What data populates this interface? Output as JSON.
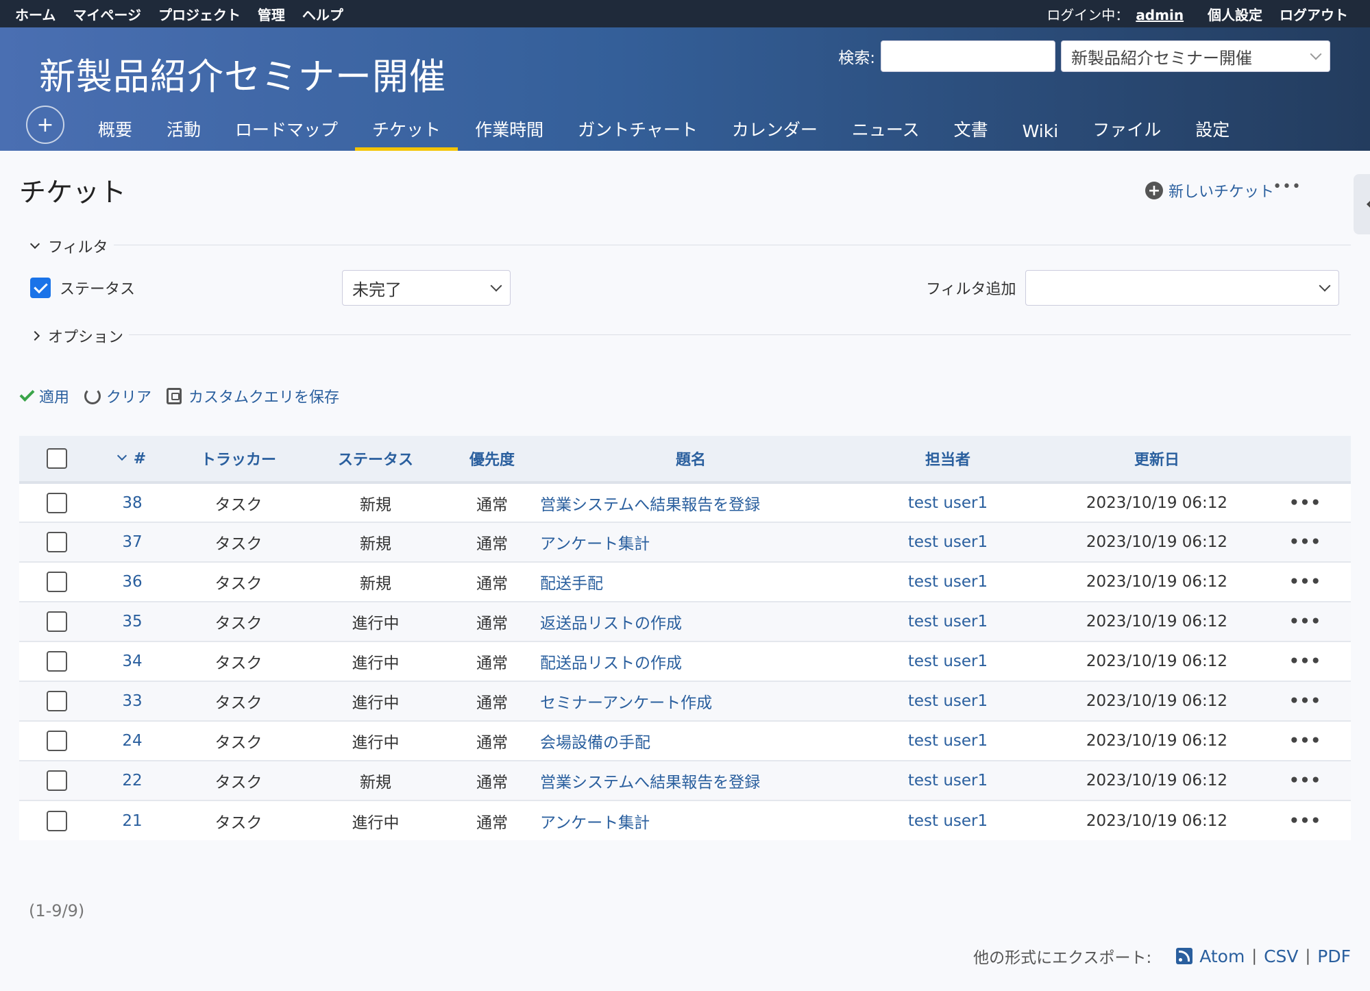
{
  "top_menu": {
    "left": [
      "ホーム",
      "マイページ",
      "プロジェクト",
      "管理",
      "ヘルプ"
    ],
    "login_label": "ログイン中：",
    "login_user": "admin",
    "my_account": "個人設定",
    "logout": "ログアウト"
  },
  "header": {
    "project_title": "新製品紹介セミナー開催",
    "search_label": "検索:",
    "search_value": "",
    "project_select": "新製品紹介セミナー開催"
  },
  "main_menu": {
    "plus": "+",
    "tabs": [
      "概要",
      "活動",
      "ロードマップ",
      "チケット",
      "作業時間",
      "ガントチャート",
      "カレンダー",
      "ニュース",
      "文書",
      "Wiki",
      "ファイル",
      "設定"
    ],
    "active_tab": "チケット"
  },
  "page": {
    "title": "チケット",
    "new_ticket": "新しいチケット",
    "more": "•••"
  },
  "filters": {
    "legend": "フィルタ",
    "status_label": "ステータス",
    "status_checked": true,
    "status_value": "未完了",
    "add_filter_label": "フィルタ追加",
    "add_filter_value": ""
  },
  "options": {
    "legend": "オプション"
  },
  "actions": {
    "apply": "適用",
    "clear": "クリア",
    "save_query": "カスタムクエリを保存"
  },
  "table": {
    "headers": {
      "id": "#",
      "tracker": "トラッカー",
      "status": "ステータス",
      "priority": "優先度",
      "subject": "題名",
      "assignee": "担当者",
      "updated": "更新日"
    },
    "rows": [
      {
        "id": "38",
        "tracker": "タスク",
        "status": "新規",
        "priority": "通常",
        "subject": "営業システムへ結果報告を登録",
        "assignee": "test user1",
        "updated": "2023/10/19 06:12"
      },
      {
        "id": "37",
        "tracker": "タスク",
        "status": "新規",
        "priority": "通常",
        "subject": "アンケート集計",
        "assignee": "test user1",
        "updated": "2023/10/19 06:12"
      },
      {
        "id": "36",
        "tracker": "タスク",
        "status": "新規",
        "priority": "通常",
        "subject": "配送手配",
        "assignee": "test user1",
        "updated": "2023/10/19 06:12"
      },
      {
        "id": "35",
        "tracker": "タスク",
        "status": "進行中",
        "priority": "通常",
        "subject": "返送品リストの作成",
        "assignee": "test user1",
        "updated": "2023/10/19 06:12"
      },
      {
        "id": "34",
        "tracker": "タスク",
        "status": "進行中",
        "priority": "通常",
        "subject": "配送品リストの作成",
        "assignee": "test user1",
        "updated": "2023/10/19 06:12"
      },
      {
        "id": "33",
        "tracker": "タスク",
        "status": "進行中",
        "priority": "通常",
        "subject": "セミナーアンケート作成",
        "assignee": "test user1",
        "updated": "2023/10/19 06:12"
      },
      {
        "id": "24",
        "tracker": "タスク",
        "status": "進行中",
        "priority": "通常",
        "subject": "会場設備の手配",
        "assignee": "test user1",
        "updated": "2023/10/19 06:12"
      },
      {
        "id": "22",
        "tracker": "タスク",
        "status": "新規",
        "priority": "通常",
        "subject": "営業システムへ結果報告を登録",
        "assignee": "test user1",
        "updated": "2023/10/19 06:12"
      },
      {
        "id": "21",
        "tracker": "タスク",
        "status": "進行中",
        "priority": "通常",
        "subject": "アンケート集計",
        "assignee": "test user1",
        "updated": "2023/10/19 06:12"
      }
    ],
    "row_menu": "•••"
  },
  "pagination": "(1-9/9)",
  "export": {
    "label": "他の形式にエクスポート:",
    "atom": "Atom",
    "csv": "CSV",
    "pdf": "PDF",
    "sep": "|"
  },
  "colors": {
    "accent": "#2a5f9e",
    "active_tab": "#f4c400",
    "top_bar": "#1f2a3a"
  }
}
